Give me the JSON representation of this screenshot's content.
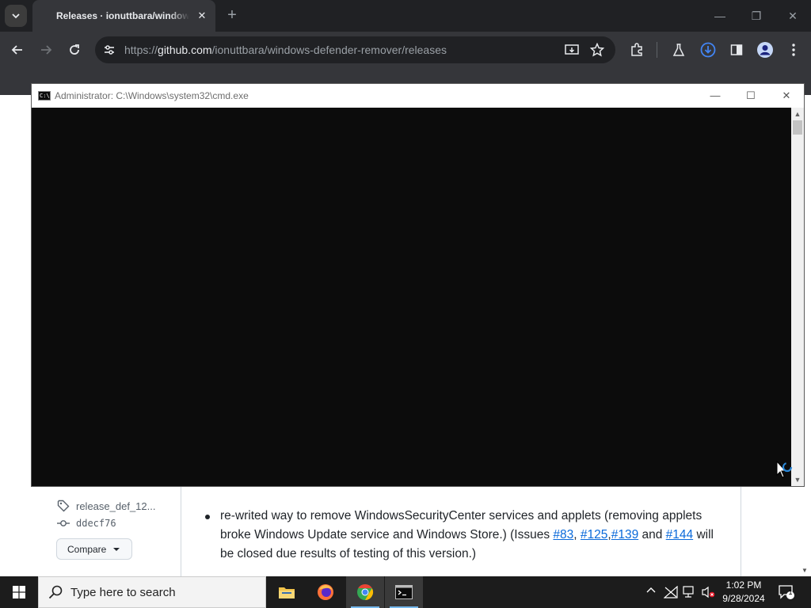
{
  "browser": {
    "tab_title": "Releases · ionuttbara/windows-defender-remover",
    "tab_close": "✕",
    "new_tab": "+",
    "url_prefix": "https://",
    "url_domain": "github.com",
    "url_path": "/ionuttbara/windows-defender-remover/releases",
    "icons": [
      "tab-search-icon",
      "back-icon",
      "forward-icon",
      "reload-icon",
      "site-info-icon",
      "install-app-icon",
      "bookmark-star-icon",
      "extensions-icon",
      "labs-icon",
      "download-icon",
      "side-panel-icon",
      "profile-icon",
      "menu-icon",
      "minimize-icon",
      "restore-icon",
      "close-icon"
    ]
  },
  "github": {
    "tag": "release_def_12...",
    "commit": "ddecf76",
    "compare_label": "Compare",
    "bullet": {
      "text_1": "re-writed way to remove WindowsSecurityCenter services and applets (removing applets broke Windows Update service and Windows Store.) (Issues ",
      "link_1": "#83",
      "sep_1": ", ",
      "link_2": "#125",
      "sep_2": ",",
      "link_3": "#139",
      "text_2": " and ",
      "link_4": "#144",
      "text_3": " will be closed due results of testing of this version.)"
    }
  },
  "cmd": {
    "title": "Administrator: C:\\Windows\\system32\\cmd.exe",
    "icon_text": "C:\\",
    "body_text": ""
  },
  "taskbar": {
    "search_placeholder": "Type here to search",
    "apps": [
      "file-explorer",
      "firefox",
      "chrome",
      "cmd"
    ],
    "time": "1:02 PM",
    "date": "9/28/2024",
    "notification_count": "1"
  },
  "colors": {
    "chrome_dark": "#202124",
    "chrome_toolbar": "#35363a",
    "cmd_bg": "#0c0c0c",
    "link_blue": "#0969da",
    "taskbar": "#1c1c1c"
  }
}
